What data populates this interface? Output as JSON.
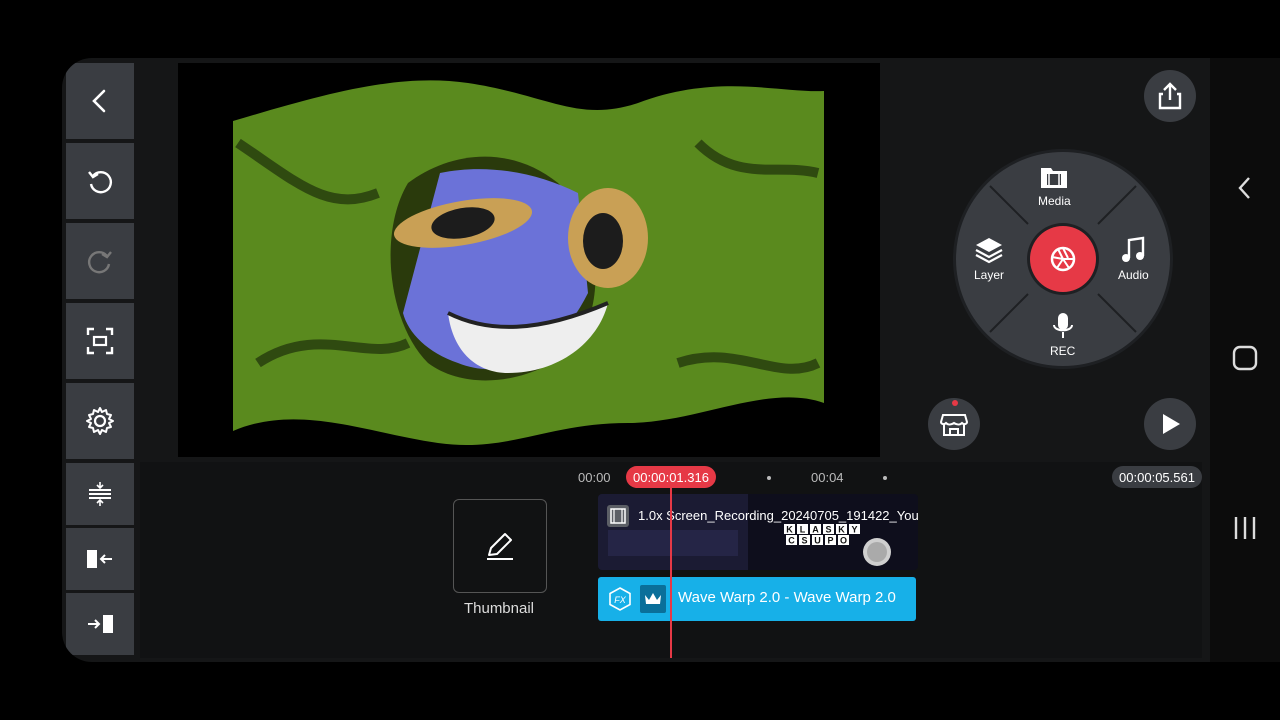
{
  "left_toolbar": {
    "buttons": [
      "back-icon",
      "undo-icon",
      "redo-icon",
      "fullscreen-icon",
      "settings-icon"
    ]
  },
  "timeline_tools": [
    "split-icon",
    "trim-left-icon",
    "trim-right-icon"
  ],
  "right_panel": {
    "wheel": {
      "media_label": "Media",
      "layer_label": "Layer",
      "audio_label": "Audio",
      "rec_label": "REC"
    }
  },
  "timeline": {
    "start_time": "00:00",
    "current_time": "00:00:01.316",
    "mid_time": "00:04",
    "total_time": "00:00:05.561",
    "thumbnail_label": "Thumbnail",
    "clip_title": "1.0x Screen_Recording_20240705_191422_You",
    "clip_thumb_text": [
      "K",
      "L",
      "A",
      "S",
      "K",
      "Y",
      "C",
      "S",
      "U",
      "P",
      "O"
    ],
    "effect_label": "Wave Warp 2.0 - Wave Warp 2.0",
    "effect_badge": "FX"
  },
  "colors": {
    "accent_red": "#e63946",
    "effect_blue": "#17b0e8",
    "button_gray": "#3a3d42"
  }
}
